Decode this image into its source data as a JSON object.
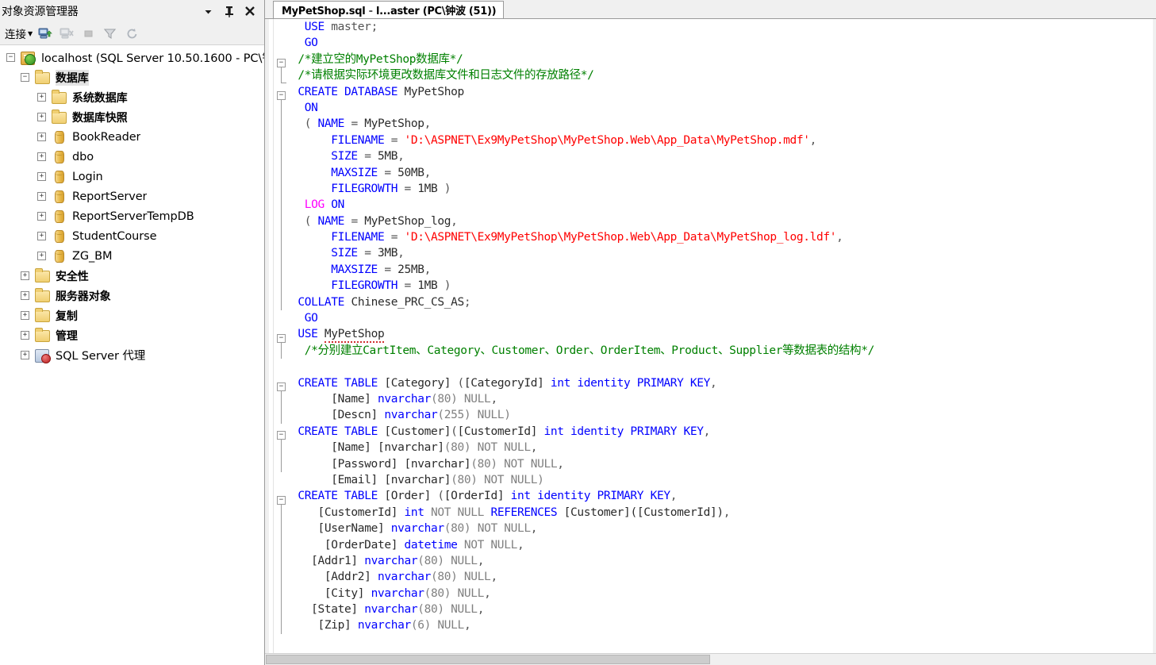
{
  "explorer": {
    "title": "对象资源管理器",
    "header_buttons": [
      {
        "name": "window-dropdown",
        "glyph": "▼"
      },
      {
        "name": "auto-hide-pin",
        "glyph": "⊥"
      },
      {
        "name": "close",
        "glyph": "✕"
      }
    ],
    "toolbar": {
      "connect_label": "连接",
      "connect_caret": "▼",
      "icons": [
        "connect-server-icon",
        "disconnect-server-icon",
        "stop-icon",
        "filter-icon",
        "refresh-icon"
      ]
    },
    "tree": [
      {
        "label": "localhost (SQL Server 10.50.1600 - PC\\钅",
        "icon": "server",
        "indent": 0,
        "expander": "−",
        "selected": false,
        "cn": false
      },
      {
        "label": "数据库",
        "icon": "folder",
        "indent": 1,
        "expander": "−",
        "selected": true,
        "cn": true
      },
      {
        "label": "系统数据库",
        "icon": "folder",
        "indent": 2,
        "expander": "+",
        "selected": false,
        "cn": true
      },
      {
        "label": "数据库快照",
        "icon": "folder",
        "indent": 2,
        "expander": "+",
        "selected": false,
        "cn": true
      },
      {
        "label": "BookReader",
        "icon": "db",
        "indent": 2,
        "expander": "+",
        "selected": false,
        "cn": false
      },
      {
        "label": "dbo",
        "icon": "db",
        "indent": 2,
        "expander": "+",
        "selected": false,
        "cn": false
      },
      {
        "label": "Login",
        "icon": "db",
        "indent": 2,
        "expander": "+",
        "selected": false,
        "cn": false
      },
      {
        "label": "ReportServer",
        "icon": "db",
        "indent": 2,
        "expander": "+",
        "selected": false,
        "cn": false
      },
      {
        "label": "ReportServerTempDB",
        "icon": "db",
        "indent": 2,
        "expander": "+",
        "selected": false,
        "cn": false
      },
      {
        "label": "StudentCourse",
        "icon": "db",
        "indent": 2,
        "expander": "+",
        "selected": false,
        "cn": false
      },
      {
        "label": "ZG_BM",
        "icon": "db",
        "indent": 2,
        "expander": "+",
        "selected": false,
        "cn": false
      },
      {
        "label": "安全性",
        "icon": "folder",
        "indent": 1,
        "expander": "+",
        "selected": false,
        "cn": true
      },
      {
        "label": "服务器对象",
        "icon": "folder",
        "indent": 1,
        "expander": "+",
        "selected": false,
        "cn": true
      },
      {
        "label": "复制",
        "icon": "folder",
        "indent": 1,
        "expander": "+",
        "selected": false,
        "cn": true
      },
      {
        "label": "管理",
        "icon": "folder",
        "indent": 1,
        "expander": "+",
        "selected": false,
        "cn": true
      },
      {
        "label": "SQL Server 代理",
        "icon": "agent",
        "indent": 1,
        "expander": "+",
        "selected": false,
        "cn": false
      }
    ]
  },
  "editor": {
    "tab": {
      "file": "MyPetShop.sql",
      "separator": " - ",
      "connection": "l...aster (PC\\钟波 (51))"
    },
    "colors": {
      "keyword": "#0000ff",
      "keyword_alt": "#ff00ff",
      "string": "#ff0000",
      "comment": "#008000",
      "identifier": "#2b2b2b",
      "plain": "#545454"
    },
    "lines": [
      [
        {
          "t": "  ",
          "c": "pl"
        },
        {
          "t": "USE",
          "c": "kw"
        },
        {
          "t": " master;",
          "c": "pl"
        }
      ],
      [
        {
          "t": "  GO",
          "c": "kw"
        }
      ],
      [
        {
          "t": " ",
          "c": "pl"
        },
        {
          "t": "/*建立空的MyPetShop数据库*/",
          "c": "cmt"
        }
      ],
      [
        {
          "t": " ",
          "c": "pl"
        },
        {
          "t": "/*请根据实际环境更改数据库文件和日志文件的存放路径*/",
          "c": "cmt"
        }
      ],
      [
        {
          "t": " ",
          "c": "pl"
        },
        {
          "t": "CREATE DATABASE",
          "c": "kw"
        },
        {
          "t": " ",
          "c": "pl"
        },
        {
          "t": "MyPetShop",
          "c": "id"
        }
      ],
      [
        {
          "t": "  ",
          "c": "pl"
        },
        {
          "t": "ON",
          "c": "kw"
        }
      ],
      [
        {
          "t": "  ( ",
          "c": "pl"
        },
        {
          "t": "NAME",
          "c": "kw"
        },
        {
          "t": " = ",
          "c": "pl"
        },
        {
          "t": "MyPetShop",
          "c": "id"
        },
        {
          "t": ",",
          "c": "pl"
        }
      ],
      [
        {
          "t": "      ",
          "c": "pl"
        },
        {
          "t": "FILENAME",
          "c": "kw"
        },
        {
          "t": " = ",
          "c": "pl"
        },
        {
          "t": "'D:\\ASPNET\\Ex9MyPetShop\\MyPetShop.Web\\App_Data\\MyPetShop.mdf'",
          "c": "str"
        },
        {
          "t": ",",
          "c": "pl"
        }
      ],
      [
        {
          "t": "      ",
          "c": "pl"
        },
        {
          "t": "SIZE",
          "c": "kw"
        },
        {
          "t": " = ",
          "c": "pl"
        },
        {
          "t": "5MB",
          "c": "id"
        },
        {
          "t": ",",
          "c": "pl"
        }
      ],
      [
        {
          "t": "      ",
          "c": "pl"
        },
        {
          "t": "MAXSIZE",
          "c": "kw"
        },
        {
          "t": " = ",
          "c": "pl"
        },
        {
          "t": "50MB",
          "c": "id"
        },
        {
          "t": ",",
          "c": "pl"
        }
      ],
      [
        {
          "t": "      ",
          "c": "pl"
        },
        {
          "t": "FILEGROWTH",
          "c": "kw"
        },
        {
          "t": " = ",
          "c": "pl"
        },
        {
          "t": "1MB",
          "c": "id"
        },
        {
          "t": " )",
          "c": "pl"
        }
      ],
      [
        {
          "t": "  ",
          "c": "pl"
        },
        {
          "t": "LOG",
          "c": "kw2"
        },
        {
          "t": " ",
          "c": "pl"
        },
        {
          "t": "ON",
          "c": "kw"
        }
      ],
      [
        {
          "t": "  ( ",
          "c": "pl"
        },
        {
          "t": "NAME",
          "c": "kw"
        },
        {
          "t": " = ",
          "c": "pl"
        },
        {
          "t": "MyPetShop_log",
          "c": "id"
        },
        {
          "t": ",",
          "c": "pl"
        }
      ],
      [
        {
          "t": "      ",
          "c": "pl"
        },
        {
          "t": "FILENAME",
          "c": "kw"
        },
        {
          "t": " = ",
          "c": "pl"
        },
        {
          "t": "'D:\\ASPNET\\Ex9MyPetShop\\MyPetShop.Web\\App_Data\\MyPetShop_log.ldf'",
          "c": "str"
        },
        {
          "t": ",",
          "c": "pl"
        }
      ],
      [
        {
          "t": "      ",
          "c": "pl"
        },
        {
          "t": "SIZE",
          "c": "kw"
        },
        {
          "t": " = ",
          "c": "pl"
        },
        {
          "t": "3MB",
          "c": "id"
        },
        {
          "t": ",",
          "c": "pl"
        }
      ],
      [
        {
          "t": "      ",
          "c": "pl"
        },
        {
          "t": "MAXSIZE",
          "c": "kw"
        },
        {
          "t": " = ",
          "c": "pl"
        },
        {
          "t": "25MB",
          "c": "id"
        },
        {
          "t": ",",
          "c": "pl"
        }
      ],
      [
        {
          "t": "      ",
          "c": "pl"
        },
        {
          "t": "FILEGROWTH",
          "c": "kw"
        },
        {
          "t": " = ",
          "c": "pl"
        },
        {
          "t": "1MB",
          "c": "id"
        },
        {
          "t": " )",
          "c": "pl"
        }
      ],
      [
        {
          "t": " ",
          "c": "pl"
        },
        {
          "t": "COLLATE",
          "c": "kw"
        },
        {
          "t": " ",
          "c": "pl"
        },
        {
          "t": "Chinese_PRC_CS_AS",
          "c": "id"
        },
        {
          "t": ";",
          "c": "pl"
        }
      ],
      [
        {
          "t": "  GO",
          "c": "kw"
        }
      ],
      [
        {
          "t": " ",
          "c": "pl"
        },
        {
          "t": "USE",
          "c": "kw"
        },
        {
          "t": " ",
          "c": "pl"
        },
        {
          "t": "MyPetShop",
          "c": "id sq"
        }
      ],
      [
        {
          "t": "  ",
          "c": "pl"
        },
        {
          "t": "/*分别建立CartItem、Category、Customer、Order、OrderItem、Product、Supplier等数据表的结构*/",
          "c": "cmt"
        }
      ],
      [
        {
          "t": "",
          "c": "pl"
        }
      ],
      [
        {
          "t": " ",
          "c": "pl"
        },
        {
          "t": "CREATE TABLE",
          "c": "kw"
        },
        {
          "t": " ",
          "c": "pl"
        },
        {
          "t": "[Category]",
          "c": "id"
        },
        {
          "t": " (",
          "c": "pl"
        },
        {
          "t": "[CategoryId]",
          "c": "id"
        },
        {
          "t": " ",
          "c": "pl"
        },
        {
          "t": "int identity PRIMARY KEY",
          "c": "kw"
        },
        {
          "t": ",",
          "c": "pl"
        }
      ],
      [
        {
          "t": "      ",
          "c": "pl"
        },
        {
          "t": "[Name]",
          "c": "id"
        },
        {
          "t": " ",
          "c": "pl"
        },
        {
          "t": "nvarchar",
          "c": "kw"
        },
        {
          "t": "(80) ",
          "c": "gray"
        },
        {
          "t": "NULL",
          "c": "gray"
        },
        {
          "t": ",",
          "c": "pl"
        }
      ],
      [
        {
          "t": "      ",
          "c": "pl"
        },
        {
          "t": "[Descn]",
          "c": "id"
        },
        {
          "t": " ",
          "c": "pl"
        },
        {
          "t": "nvarchar",
          "c": "kw"
        },
        {
          "t": "(255) ",
          "c": "gray"
        },
        {
          "t": "NULL)",
          "c": "gray"
        }
      ],
      [
        {
          "t": " ",
          "c": "pl"
        },
        {
          "t": "CREATE TABLE",
          "c": "kw"
        },
        {
          "t": " ",
          "c": "pl"
        },
        {
          "t": "[Customer]",
          "c": "id"
        },
        {
          "t": "(",
          "c": "pl"
        },
        {
          "t": "[CustomerId]",
          "c": "id"
        },
        {
          "t": " ",
          "c": "pl"
        },
        {
          "t": "int identity PRIMARY KEY",
          "c": "kw"
        },
        {
          "t": ",",
          "c": "pl"
        }
      ],
      [
        {
          "t": "      ",
          "c": "pl"
        },
        {
          "t": "[Name] [nvarchar]",
          "c": "id"
        },
        {
          "t": "(80) ",
          "c": "gray"
        },
        {
          "t": "NOT NULL",
          "c": "gray"
        },
        {
          "t": ",",
          "c": "pl"
        }
      ],
      [
        {
          "t": "      ",
          "c": "pl"
        },
        {
          "t": "[Password] [nvarchar]",
          "c": "id"
        },
        {
          "t": "(80) ",
          "c": "gray"
        },
        {
          "t": "NOT NULL",
          "c": "gray"
        },
        {
          "t": ",",
          "c": "pl"
        }
      ],
      [
        {
          "t": "      ",
          "c": "pl"
        },
        {
          "t": "[Email] [nvarchar]",
          "c": "id"
        },
        {
          "t": "(80) ",
          "c": "gray"
        },
        {
          "t": "NOT NULL)",
          "c": "gray"
        }
      ],
      [
        {
          "t": " ",
          "c": "pl"
        },
        {
          "t": "CREATE TABLE",
          "c": "kw"
        },
        {
          "t": " ",
          "c": "pl"
        },
        {
          "t": "[Order]",
          "c": "id"
        },
        {
          "t": " (",
          "c": "pl"
        },
        {
          "t": "[OrderId]",
          "c": "id"
        },
        {
          "t": " ",
          "c": "pl"
        },
        {
          "t": "int identity PRIMARY KEY",
          "c": "kw"
        },
        {
          "t": ",",
          "c": "pl"
        }
      ],
      [
        {
          "t": "    ",
          "c": "pl"
        },
        {
          "t": "[CustomerId]",
          "c": "id"
        },
        {
          "t": " ",
          "c": "pl"
        },
        {
          "t": "int",
          "c": "kw"
        },
        {
          "t": " NOT NULL ",
          "c": "gray"
        },
        {
          "t": "REFERENCES",
          "c": "kw"
        },
        {
          "t": " ",
          "c": "pl"
        },
        {
          "t": "[Customer]([CustomerId])",
          "c": "id"
        },
        {
          "t": ",",
          "c": "pl"
        }
      ],
      [
        {
          "t": "    ",
          "c": "pl"
        },
        {
          "t": "[UserName]",
          "c": "id"
        },
        {
          "t": " ",
          "c": "pl"
        },
        {
          "t": "nvarchar",
          "c": "kw"
        },
        {
          "t": "(80) ",
          "c": "gray"
        },
        {
          "t": "NOT NULL",
          "c": "gray"
        },
        {
          "t": ",",
          "c": "pl"
        }
      ],
      [
        {
          "t": "     ",
          "c": "pl"
        },
        {
          "t": "[OrderDate]",
          "c": "id"
        },
        {
          "t": " ",
          "c": "pl"
        },
        {
          "t": "datetime",
          "c": "kw"
        },
        {
          "t": " NOT NULL",
          "c": "gray"
        },
        {
          "t": ",",
          "c": "pl"
        }
      ],
      [
        {
          "t": "   ",
          "c": "pl"
        },
        {
          "t": "[Addr1]",
          "c": "id"
        },
        {
          "t": " ",
          "c": "pl"
        },
        {
          "t": "nvarchar",
          "c": "kw"
        },
        {
          "t": "(80) ",
          "c": "gray"
        },
        {
          "t": "NULL",
          "c": "gray"
        },
        {
          "t": ",",
          "c": "pl"
        }
      ],
      [
        {
          "t": "     ",
          "c": "pl"
        },
        {
          "t": "[Addr2]",
          "c": "id"
        },
        {
          "t": " ",
          "c": "pl"
        },
        {
          "t": "nvarchar",
          "c": "kw"
        },
        {
          "t": "(80) ",
          "c": "gray"
        },
        {
          "t": "NULL",
          "c": "gray"
        },
        {
          "t": ",",
          "c": "pl"
        }
      ],
      [
        {
          "t": "     ",
          "c": "pl"
        },
        {
          "t": "[City]",
          "c": "id"
        },
        {
          "t": " ",
          "c": "pl"
        },
        {
          "t": "nvarchar",
          "c": "kw"
        },
        {
          "t": "(80) ",
          "c": "gray"
        },
        {
          "t": "NULL",
          "c": "gray"
        },
        {
          "t": ",",
          "c": "pl"
        }
      ],
      [
        {
          "t": "   ",
          "c": "pl"
        },
        {
          "t": "[State]",
          "c": "id"
        },
        {
          "t": " ",
          "c": "pl"
        },
        {
          "t": "nvarchar",
          "c": "kw"
        },
        {
          "t": "(80) ",
          "c": "gray"
        },
        {
          "t": "NULL",
          "c": "gray"
        },
        {
          "t": ",",
          "c": "pl"
        }
      ],
      [
        {
          "t": "    ",
          "c": "pl"
        },
        {
          "t": "[Zip]",
          "c": "id"
        },
        {
          "t": " ",
          "c": "pl"
        },
        {
          "t": "nvarchar",
          "c": "kw"
        },
        {
          "t": "(6) ",
          "c": "gray"
        },
        {
          "t": "NULL",
          "c": "gray"
        },
        {
          "t": ",",
          "c": "pl"
        }
      ]
    ],
    "fold_markers": [
      {
        "line": 2,
        "type": "box",
        "glyph": "−"
      },
      {
        "line": 3,
        "type": "end"
      },
      {
        "line": 4,
        "type": "box",
        "glyph": "−"
      },
      {
        "line": 19,
        "type": "box",
        "glyph": "−"
      },
      {
        "line": 22,
        "type": "box",
        "glyph": "−"
      },
      {
        "line": 25,
        "type": "box",
        "glyph": "−"
      },
      {
        "line": 29,
        "type": "box",
        "glyph": "−"
      }
    ]
  }
}
